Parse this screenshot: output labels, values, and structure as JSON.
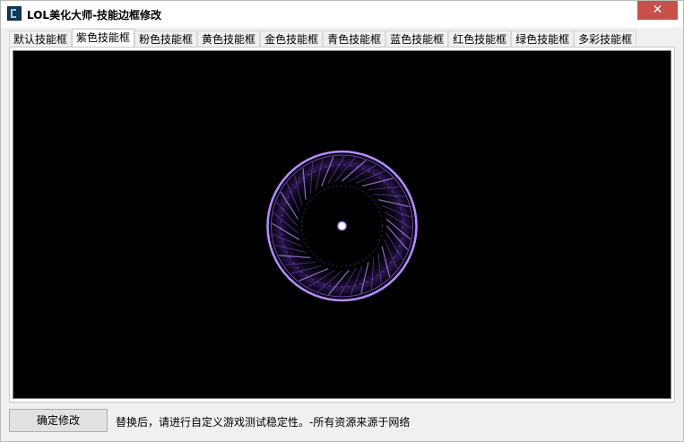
{
  "window": {
    "title": "LOL美化大师-技能边框修改",
    "close_glyph": "✕"
  },
  "tabs": [
    {
      "label": "默认技能框",
      "active": false
    },
    {
      "label": "紫色技能框",
      "active": true
    },
    {
      "label": "粉色技能框",
      "active": false
    },
    {
      "label": "黄色技能框",
      "active": false
    },
    {
      "label": "金色技能框",
      "active": false
    },
    {
      "label": "青色技能框",
      "active": false
    },
    {
      "label": "蓝色技能框",
      "active": false
    },
    {
      "label": "红色技能框",
      "active": false
    },
    {
      "label": "绿色技能框",
      "active": false
    },
    {
      "label": "多彩技能框",
      "active": false
    }
  ],
  "preview": {
    "ring_color": "#b58cff",
    "glow_color": "#7a4fd6"
  },
  "footer": {
    "confirm_label": "确定修改",
    "status": "替换后，请进行自定义游戏测试稳定性。-所有资源来源于网络"
  }
}
